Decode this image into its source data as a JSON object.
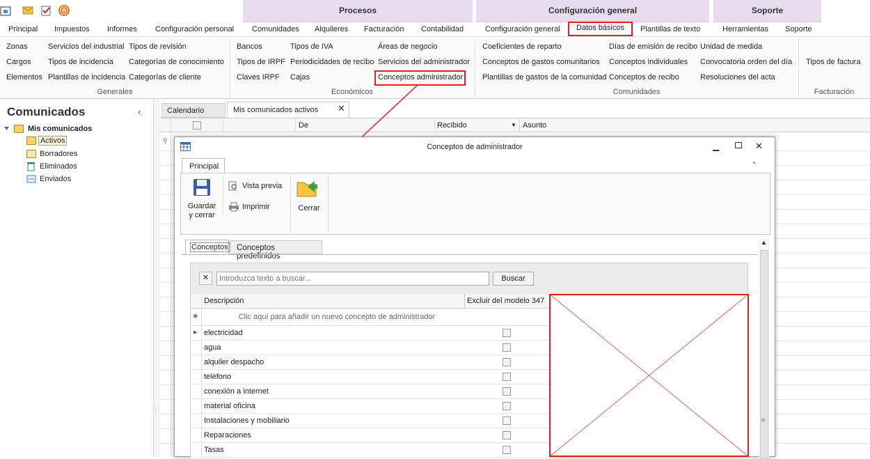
{
  "quick_access": {
    "icons": [
      "home-icon",
      "mail-icon",
      "checklist-icon",
      "rss-icon"
    ]
  },
  "context_groups": {
    "procesos": "Procesos",
    "config": "Configuración general",
    "soporte": "Soporte"
  },
  "tabs": [
    "Principal",
    "Impuestos",
    "Informes",
    "Configuración personal",
    "Comunidades",
    "Alquileres",
    "Facturación",
    "Contabilidad",
    "Configuración general",
    "Datos básicos",
    "Plantillas de texto",
    "Herramientas",
    "Soporte"
  ],
  "ribbon": {
    "generales": {
      "items": [
        "Zonas",
        "Cargos",
        "Elementos",
        "Servicios del industrial",
        "Tipos de incidencia",
        "Plantillas de incidencia",
        "Tipos de revisión",
        "Categorías de conocimiento",
        "Categorías de cliente"
      ],
      "label": "Generales"
    },
    "economicos": {
      "items": [
        "Bancos",
        "Tipos de IRPF",
        "Claves IRPF",
        "Tipos de IVA",
        "Periodicidades de recibo",
        "Cajas",
        "Áreas de negocio",
        "Servicios del administrador",
        "Conceptos administrador"
      ],
      "label": "Económicos"
    },
    "comunidades": {
      "items": [
        "Coeficientes de reparto",
        "Conceptos de gastos comunitarios",
        "Plantillas de gastos de la comunidad",
        "Días de emisión de recibo",
        "Conceptos individuales",
        "Conceptos de recibo",
        "Unidad de medida",
        "Convocatoria orden del día",
        "Resoluciones del acta"
      ],
      "label": "Comunidades"
    },
    "facturacion": {
      "items": [
        "Tipos de factura"
      ],
      "label": "Facturación"
    }
  },
  "nav": {
    "title": "Comunicados",
    "root": "Mis comunicados",
    "items": [
      "Activos",
      "Borradores",
      "Eliminados",
      "Enviados"
    ]
  },
  "doc_tabs": [
    "Calendario",
    "Mis comunicados activos"
  ],
  "grid_headers": [
    "De",
    "Recibido",
    "Asunto"
  ],
  "dialog": {
    "title": "Conceptos de administrador",
    "ribbon_tab": "Principal",
    "buttons": {
      "save": "Guardar y cerrar",
      "save_l1": "Guardar",
      "save_l2": "y cerrar",
      "preview": "Vista previa",
      "print": "Imprimir",
      "close": "Cerrar"
    },
    "tabs": [
      "Conceptos",
      "Conceptos predefinidos"
    ],
    "search": {
      "placeholder": "Introduzca texto a buscar...",
      "button": "Buscar"
    },
    "columns": [
      "Descripción",
      "Excluir del modelo 347"
    ],
    "new_row": "Clic aquí para añadir un nuevo concepto de administrador",
    "rows": [
      "electricidad",
      "agua",
      "alquiler despacho",
      "teléfono",
      "conexión a internet",
      "material oficina",
      "Instalaciones y mobiliario",
      "Reparaciones",
      "Tasas"
    ]
  },
  "colors": {
    "highlight": "#e02020",
    "context_band": "#e8ddf0"
  }
}
